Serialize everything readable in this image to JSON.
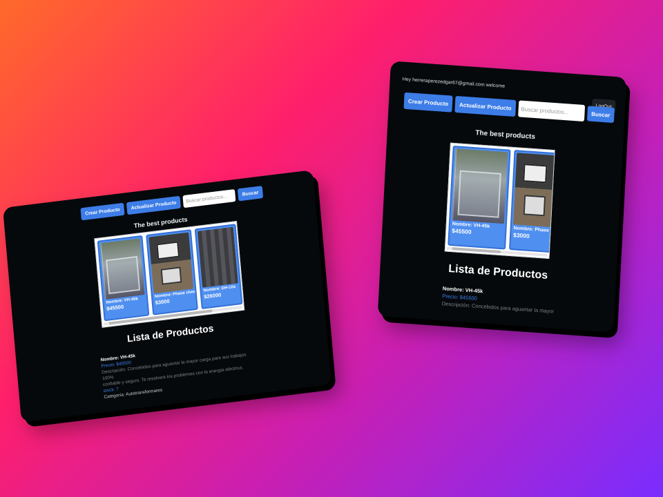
{
  "left": {
    "toolbar": {
      "crear": "Crear Producto",
      "actualizar": "Actualizar Producto",
      "search_placeholder": "Buscar productos...",
      "buscar": "Buscar"
    },
    "best_title": "The best products",
    "cards": [
      {
        "name": "Nombre: VH-45k",
        "price": "$45500"
      },
      {
        "name": "Nombre: Phase checker",
        "price": "$3000"
      },
      {
        "name": "Nombre: DH-10s",
        "price": "$26000"
      }
    ],
    "list_title": "Lista de Productos",
    "detail": {
      "name": "Nombre: VH-45k",
      "price": "Precio: $45500",
      "desc1": "Descripción: Concebidos para aguantar la mayor carga para sus trabajos 100%",
      "desc2": "confiable y seguro. Te resolverá los problemas con la energía eléctrica.",
      "stock": "stock: 7",
      "category": "Categoría: Autotransformares"
    }
  },
  "right": {
    "greeting": "Hey herreraperezedgar67@gmail.com welcome",
    "logout": "LogOut",
    "toolbar": {
      "crear": "Crear Producto",
      "actualizar": "Actualizar Producto",
      "search_placeholder": "Buscar productos...",
      "buscar": "Buscar"
    },
    "best_title": "The best products",
    "cards": [
      {
        "name": "Nombre: VH-45k",
        "price": "$45500"
      },
      {
        "name": "Nombre: Phase c",
        "price": "$3000"
      }
    ],
    "list_title": "Lista de Productos",
    "detail": {
      "name": "Nombre: VH-45k",
      "price": "Precio: $45500",
      "desc1": "Descripción: Concebidos para aguantar la mayor"
    }
  }
}
